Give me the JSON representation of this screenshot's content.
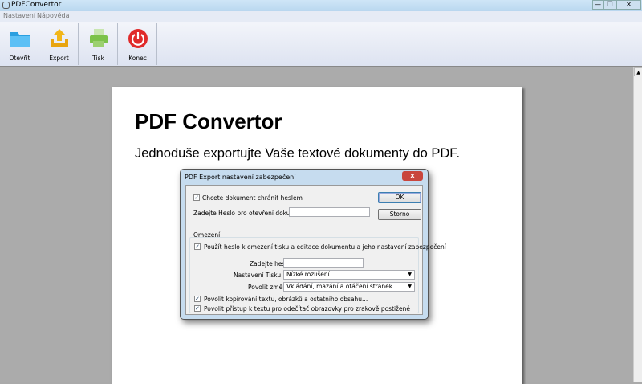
{
  "window": {
    "title": "PDFConvertor",
    "minimize": "—",
    "restore": "❐",
    "close": "✕"
  },
  "menu": [
    "Nastavení",
    "Nápověda"
  ],
  "toolbar": [
    {
      "label": "Otevřít",
      "icon": "folder-icon",
      "color": "#2a9fe0"
    },
    {
      "label": "Export",
      "icon": "export-icon",
      "color": "#f2b618"
    },
    {
      "label": "Tisk",
      "icon": "printer-icon",
      "color": "#7cc24a"
    },
    {
      "label": "Konec",
      "icon": "power-icon",
      "color": "#e02a2a"
    }
  ],
  "page": {
    "title": "PDF Convertor",
    "subtitle": "Jednoduše exportujte Vaše textové dokumenty do PDF."
  },
  "dialog": {
    "title": "PDF Export nastavení zabezpečení",
    "close": "x",
    "protect_label": "Chcete dokument chránit heslem",
    "protect_checked": true,
    "open_password_label": "Zadejte Heslo pro otevření dokumentu:",
    "open_password_value": "",
    "ok": "OK",
    "cancel": "Storno",
    "group_title": "Omezení",
    "restrict_label": "Použít heslo k omezení tisku a editace dokumentu a jeho nastavení zabezpečení",
    "restrict_checked": true,
    "password_label": "Zadejte heslo::",
    "password_value": "",
    "print_label": "Nastavení Tisku:",
    "print_value": "Nízké rozlišení",
    "changes_label": "Povolit změny:",
    "changes_value": "Vkládání, mazání a otáčení stránek",
    "copy_label": "Povolit kopírování textu, obrázků a ostatního obsahu...",
    "copy_checked": true,
    "access_label": "Povolit přístup k textu pro odečítač obrazovky pro zrakově postižené",
    "access_checked": true,
    "check": "✓",
    "arrow": "▼"
  },
  "scrollbar": {
    "up": "▲"
  }
}
